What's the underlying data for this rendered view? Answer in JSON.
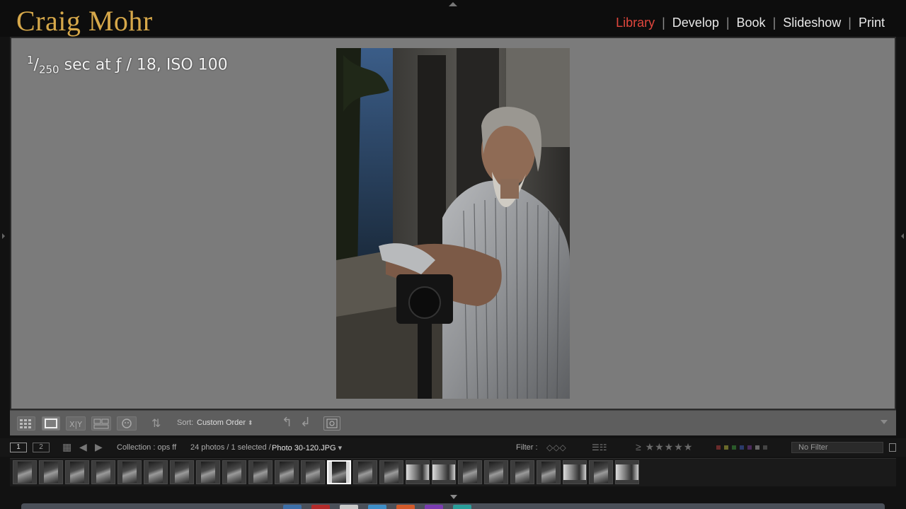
{
  "app": {
    "brand": "Craig Mohr",
    "modules": [
      {
        "label": "Library",
        "active": true
      },
      {
        "label": "Develop",
        "active": false
      },
      {
        "label": "Book",
        "active": false
      },
      {
        "label": "Slideshow",
        "active": false
      },
      {
        "label": "Print",
        "active": false
      }
    ]
  },
  "loupe": {
    "exif_num": "1",
    "exif_den": "250",
    "exif_rest": " sec at ƒ / 18, ISO 100"
  },
  "toolbar": {
    "sort_label": "Sort:",
    "sort_value": "Custom Order"
  },
  "filmstrip_header": {
    "screen1": "1",
    "screen2": "2",
    "collection": "Collection : ops ff",
    "count": "24 photos / 1 selected /",
    "filename": "Photo 30-120.JPG",
    "filter_label": "Filter :",
    "no_filter": "No Filter"
  },
  "filmstrip": {
    "thumbnails": [
      "portrait",
      "portrait",
      "portrait",
      "portrait",
      "portrait",
      "portrait",
      "portrait",
      "portrait",
      "portrait",
      "portrait",
      "portrait",
      "portrait",
      "portrait",
      "portrait",
      "portrait",
      "landscape",
      "landscape",
      "portrait",
      "portrait",
      "portrait",
      "portrait",
      "landscape",
      "portrait",
      "landscape"
    ],
    "selected_index": 12
  },
  "colors": {
    "brand": "#d6a84a",
    "active_module": "#e0463d",
    "loupe_bg": "#7b7b7b"
  }
}
